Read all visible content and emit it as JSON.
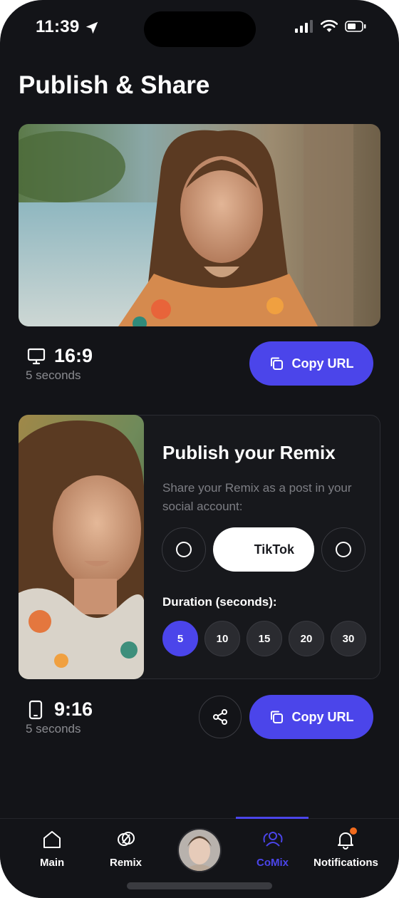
{
  "status_bar": {
    "time": "11:39"
  },
  "page": {
    "title": "Publish & Share"
  },
  "landscape": {
    "ratio": "16:9",
    "duration": "5 seconds",
    "copy_label": "Copy URL"
  },
  "remix": {
    "title": "Publish your Remix",
    "description": "Share your Remix as a post in your social account:",
    "social": {
      "selected": "TikTok"
    },
    "duration_label": "Duration (seconds):",
    "durations": [
      "5",
      "10",
      "15",
      "20",
      "30"
    ],
    "selected_duration": "5"
  },
  "portrait": {
    "ratio": "9:16",
    "duration": "5 seconds",
    "copy_label": "Copy URL"
  },
  "nav": {
    "items": [
      {
        "label": "Main",
        "icon": "home-icon"
      },
      {
        "label": "Remix",
        "icon": "remix-icon"
      },
      {
        "label": "",
        "icon": "avatar"
      },
      {
        "label": "CoMix",
        "icon": "comix-icon"
      },
      {
        "label": "Notifications",
        "icon": "bell-icon"
      }
    ],
    "active": "CoMix"
  },
  "colors": {
    "accent": "#4b45ea",
    "background": "#131418",
    "notification_dot": "#f26b1d"
  }
}
